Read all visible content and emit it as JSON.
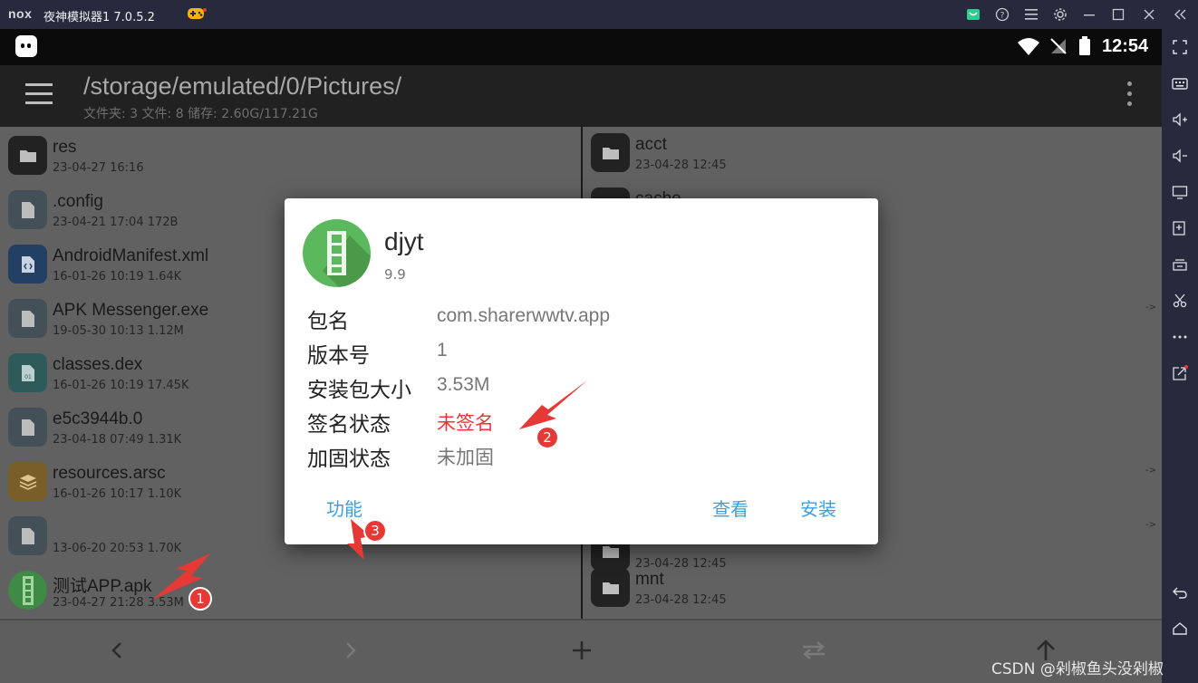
{
  "window": {
    "logo": "nox",
    "title": "夜神模拟器1 7.0.5.2"
  },
  "statusbar": {
    "time": "12:54"
  },
  "appbar": {
    "path": "/storage/emulated/0/Pictures/",
    "summary": "文件夹: 3  文件: 8  储存: 2.60G/117.21G"
  },
  "left_pane": {
    "items": [
      {
        "name": "res",
        "meta": "23-04-27 16:16",
        "icon": "folder-icon"
      },
      {
        "name": ".config",
        "meta": "23-04-21 17:04  172B",
        "icon": "file-icon"
      },
      {
        "name": "AndroidManifest.xml",
        "meta": "16-01-26 10:19  1.64K",
        "icon": "code-file-icon"
      },
      {
        "name": "APK Messenger.exe",
        "meta": "19-05-30 10:13  1.12M",
        "icon": "file-icon"
      },
      {
        "name": "classes.dex",
        "meta": "16-01-26 10:19  17.45K",
        "icon": "binary-file-icon"
      },
      {
        "name": "e5c3944b.0",
        "meta": "23-04-18 07:49  1.31K",
        "icon": "file-icon"
      },
      {
        "name": "resources.arsc",
        "meta": "16-01-26 10:17  1.10K",
        "icon": "layers-icon"
      },
      {
        "name": "",
        "meta": "13-06-20 20:53  1.70K",
        "icon": "file-icon"
      },
      {
        "name": "测试APP.apk",
        "meta": "23-04-27 21:28  3.53M",
        "icon": "apk-icon"
      }
    ]
  },
  "right_pane": {
    "items": [
      {
        "name": "acct",
        "meta": "23-04-28 12:45"
      },
      {
        "name": "cache",
        "meta": ""
      },
      {
        "name": "",
        "meta": "23-04-28 12:45"
      },
      {
        "name": "mnt",
        "meta": "23-04-28 12:45"
      }
    ],
    "arrow": "->"
  },
  "dialog": {
    "app_name": "djyt",
    "version": "9.9",
    "rows": [
      {
        "label": "包名",
        "value": "com.sharerwwtv.app"
      },
      {
        "label": "版本号",
        "value": "1"
      },
      {
        "label": "安装包大小",
        "value": "3.53M"
      },
      {
        "label": "签名状态",
        "value": "未签名"
      },
      {
        "label": "加固状态",
        "value": "未加固"
      }
    ],
    "buttons": {
      "function": "功能",
      "view": "查看",
      "install": "安装"
    }
  },
  "annotations": {
    "badge1": "1",
    "badge2": "2",
    "badge3": "3"
  },
  "watermark": "CSDN @剁椒鱼头没剁椒",
  "colors": {
    "accent_blue": "#3f9fdc",
    "unsigned_red": "#e53935",
    "annotation_red": "#e53935",
    "emulator_chrome": "#272a3c"
  }
}
